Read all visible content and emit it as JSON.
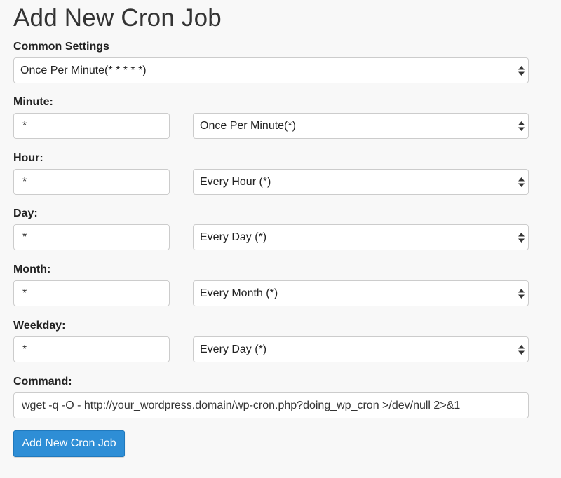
{
  "page": {
    "title": "Add New Cron Job"
  },
  "common_settings": {
    "label": "Common Settings",
    "selected": "Once Per Minute(* * * * *)"
  },
  "minute": {
    "label": "Minute:",
    "value": "*",
    "selected": "Once Per Minute(*)"
  },
  "hour": {
    "label": "Hour:",
    "value": "*",
    "selected": "Every Hour (*)"
  },
  "day": {
    "label": "Day:",
    "value": "*",
    "selected": "Every Day (*)"
  },
  "month": {
    "label": "Month:",
    "value": "*",
    "selected": "Every Month (*)"
  },
  "weekday": {
    "label": "Weekday:",
    "value": "*",
    "selected": "Every Day (*)"
  },
  "command": {
    "label": "Command:",
    "value": "wget -q -O - http://your_wordpress.domain/wp-cron.php?doing_wp_cron >/dev/null 2>&1"
  },
  "submit": {
    "label": "Add New Cron Job"
  },
  "icons": {
    "select_arrow": "up-down-arrows-icon"
  },
  "colors": {
    "button_bg": "#2e8ed6",
    "button_text": "#ffffff"
  }
}
